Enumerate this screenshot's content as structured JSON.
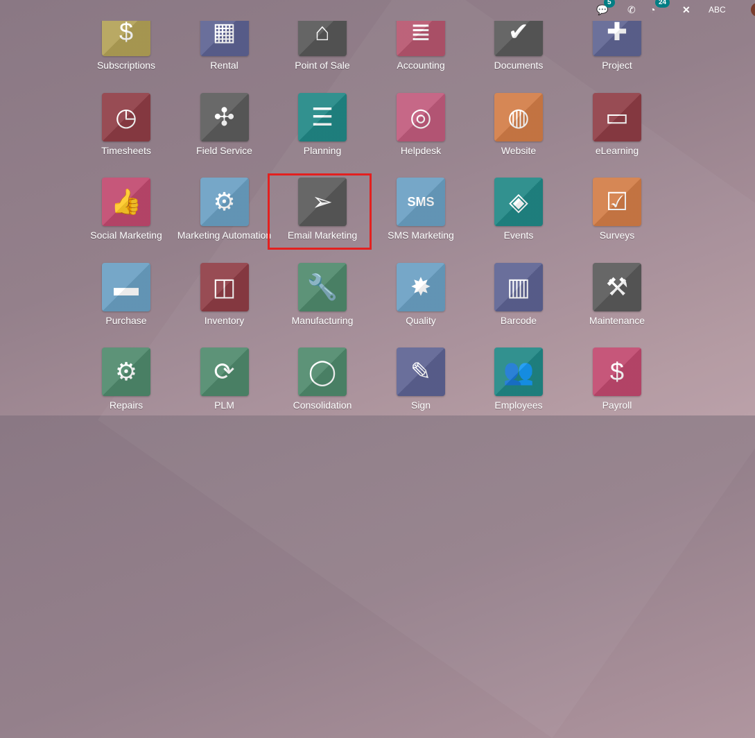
{
  "topbar": {
    "messages_badge": "5",
    "activities_badge": "24",
    "company": "ABC",
    "icons": [
      "chat-icon",
      "phone-icon",
      "clock-icon",
      "tools-icon"
    ]
  },
  "highlight_color": "#e3201f",
  "apps": [
    {
      "label": "Subscriptions",
      "color": "#b3a257",
      "glyph": "$"
    },
    {
      "label": "Rental",
      "color": "#5d6393",
      "glyph": "▦"
    },
    {
      "label": "Point of Sale",
      "color": "#585858",
      "glyph": "⌂"
    },
    {
      "label": "Accounting",
      "color": "#b7566f",
      "glyph": "≣"
    },
    {
      "label": "Documents",
      "color": "#5a5a5a",
      "glyph": "✔"
    },
    {
      "label": "Project",
      "color": "#5f6593",
      "glyph": "✚"
    },
    {
      "label": "Timesheets",
      "color": "#8f3d45",
      "glyph": "◷"
    },
    {
      "label": "Field Service",
      "color": "#5c5c5c",
      "glyph": "✣"
    },
    {
      "label": "Planning",
      "color": "#218886",
      "glyph": "☰"
    },
    {
      "label": "Helpdesk",
      "color": "#c15b7d",
      "glyph": "◎"
    },
    {
      "label": "Website",
      "color": "#d27d47",
      "glyph": "◍"
    },
    {
      "label": "eLearning",
      "color": "#8f3d45",
      "glyph": "▭"
    },
    {
      "label": "Social Marketing",
      "color": "#c1496f",
      "glyph": "👍"
    },
    {
      "label": "Marketing Automation",
      "color": "#6aa0c3",
      "glyph": "⚙"
    },
    {
      "label": "Email Marketing",
      "color": "#5a5a5a",
      "glyph": "➢"
    },
    {
      "label": "SMS Marketing",
      "color": "#6aa0c3",
      "glyph": "SMS"
    },
    {
      "label": "Events",
      "color": "#218886",
      "glyph": "◈"
    },
    {
      "label": "Surveys",
      "color": "#d27d47",
      "glyph": "☑"
    },
    {
      "label": "Purchase",
      "color": "#6aa0c3",
      "glyph": "▬"
    },
    {
      "label": "Inventory",
      "color": "#8f3d45",
      "glyph": "◫"
    },
    {
      "label": "Manufacturing",
      "color": "#4f8a6d",
      "glyph": "🔧"
    },
    {
      "label": "Quality",
      "color": "#6aa0c3",
      "glyph": "✸"
    },
    {
      "label": "Barcode",
      "color": "#5d6393",
      "glyph": "▥"
    },
    {
      "label": "Maintenance",
      "color": "#5a5a5a",
      "glyph": "⚒"
    },
    {
      "label": "Repairs",
      "color": "#4f8a6d",
      "glyph": "⚙"
    },
    {
      "label": "PLM",
      "color": "#4f8a6d",
      "glyph": "⟳"
    },
    {
      "label": "Consolidation",
      "color": "#4f8a6d",
      "glyph": "◯"
    },
    {
      "label": "Sign",
      "color": "#5d6393",
      "glyph": "✎"
    },
    {
      "label": "Employees",
      "color": "#218886",
      "glyph": "👥"
    },
    {
      "label": "Payroll",
      "color": "#c1496f",
      "glyph": "$"
    }
  ]
}
